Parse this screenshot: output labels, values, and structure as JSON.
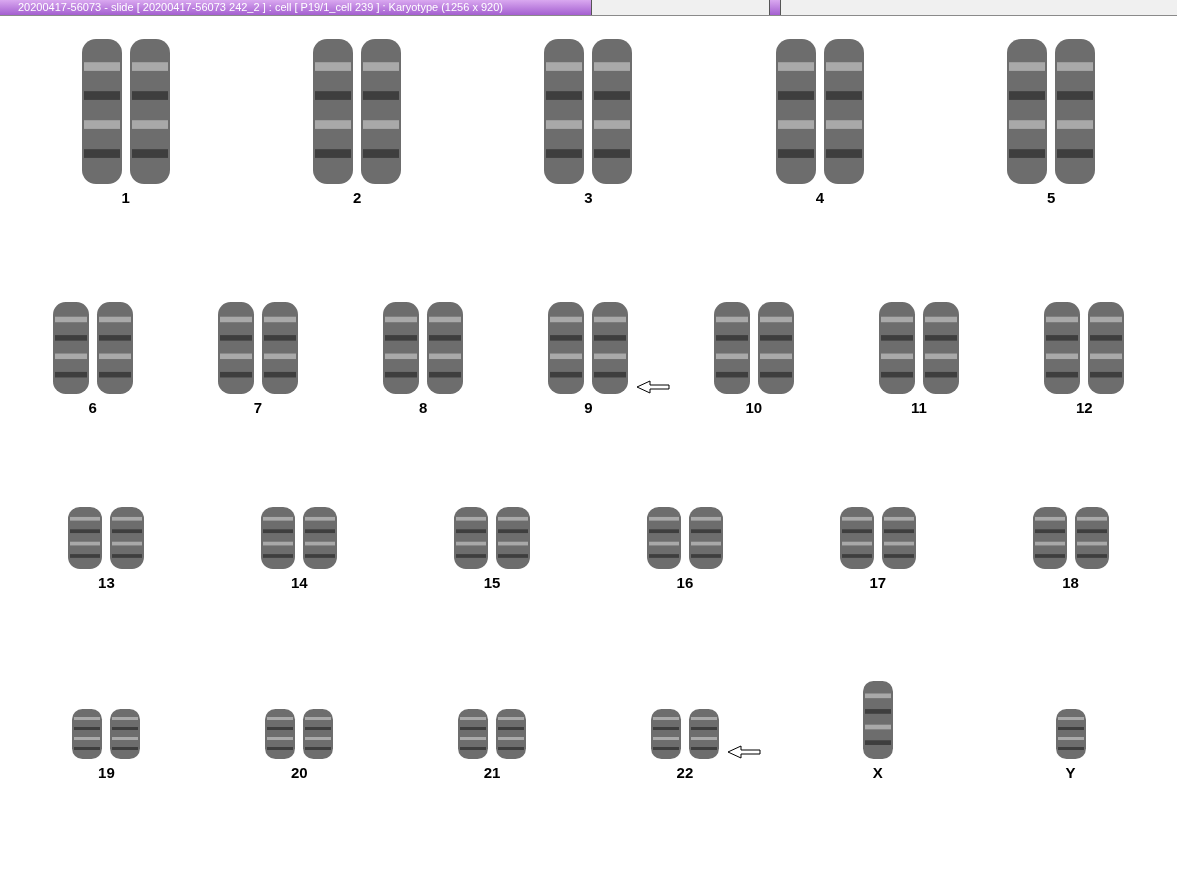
{
  "window": {
    "title": "20200417-56073 - slide [ 20200417-56073 242_2 ] : cell [ P19/1_cell 239 ] : Karyotype  (1256 x 920)"
  },
  "rows": [
    {
      "pairs": [
        {
          "label": "1",
          "kind": "pair",
          "marked": false
        },
        {
          "label": "2",
          "kind": "pair",
          "marked": false
        },
        {
          "label": "3",
          "kind": "pair",
          "marked": false
        },
        {
          "label": "4",
          "kind": "pair",
          "marked": false
        },
        {
          "label": "5",
          "kind": "pair",
          "marked": false
        }
      ]
    },
    {
      "pairs": [
        {
          "label": "6",
          "kind": "pair",
          "marked": false
        },
        {
          "label": "7",
          "kind": "pair",
          "marked": false
        },
        {
          "label": "8",
          "kind": "pair",
          "marked": false
        },
        {
          "label": "9",
          "kind": "pair",
          "marked": true
        },
        {
          "label": "10",
          "kind": "pair",
          "marked": false
        },
        {
          "label": "11",
          "kind": "pair",
          "marked": false
        },
        {
          "label": "12",
          "kind": "pair",
          "marked": false
        }
      ]
    },
    {
      "pairs": [
        {
          "label": "13",
          "kind": "pair",
          "marked": false
        },
        {
          "label": "14",
          "kind": "pair",
          "marked": false
        },
        {
          "label": "15",
          "kind": "pair",
          "marked": false
        },
        {
          "label": "16",
          "kind": "pair",
          "marked": false
        },
        {
          "label": "17",
          "kind": "pair",
          "marked": false
        },
        {
          "label": "18",
          "kind": "pair",
          "marked": false
        }
      ]
    },
    {
      "pairs": [
        {
          "label": "19",
          "kind": "pair",
          "marked": false
        },
        {
          "label": "20",
          "kind": "pair",
          "marked": false
        },
        {
          "label": "21",
          "kind": "pair",
          "marked": false
        },
        {
          "label": "22",
          "kind": "pair",
          "marked": true
        },
        {
          "label": "X",
          "kind": "single",
          "marked": false
        },
        {
          "label": "Y",
          "kind": "single",
          "marked": false
        }
      ]
    }
  ]
}
